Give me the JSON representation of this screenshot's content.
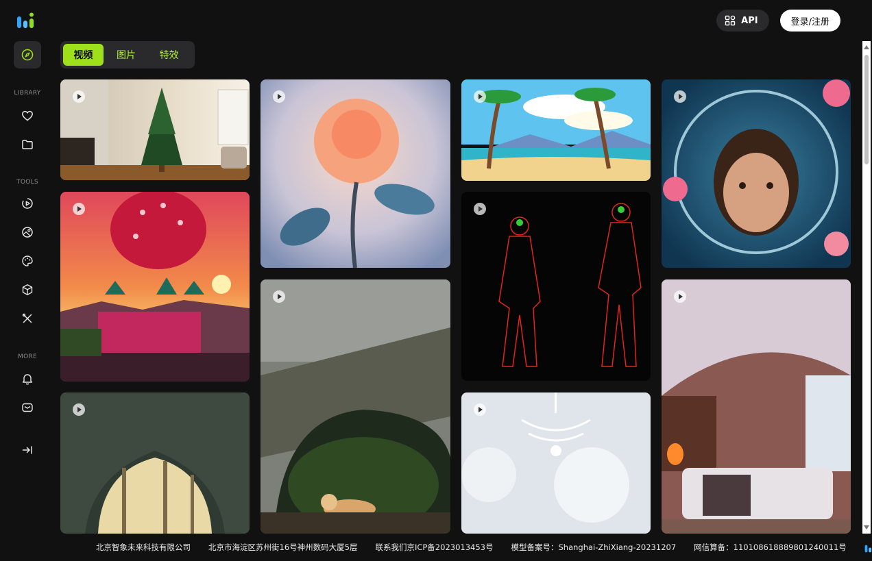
{
  "header": {
    "api_label": "API",
    "login_label": "登录/注册"
  },
  "sidebar": {
    "library_label": "LIBRARY",
    "tools_label": "TOOLS",
    "more_label": "MORE"
  },
  "tabs": [
    {
      "label": "视频",
      "active": true
    },
    {
      "label": "图片",
      "active": false
    },
    {
      "label": "特效",
      "active": false
    }
  ],
  "colors": {
    "accent": "#9ee01a",
    "background": "#111112",
    "panel": "#2a2a2c"
  },
  "icons": [
    "explore-icon",
    "heart-icon",
    "folder-icon",
    "video-tool-icon",
    "image-tool-icon",
    "palette-icon",
    "cube-icon",
    "tools-icon",
    "bell-icon",
    "mail-icon",
    "collapse-icon",
    "play-icon",
    "grid-icon"
  ],
  "footer": {
    "company": "北京智象未来科技有限公司",
    "address": "北京市海淀区苏州街16号神州数码大厦5层",
    "icp": "联系我们京ICP备2023013453号",
    "model_record": "模型备案号：Shanghai-ZhiXiang-20231207",
    "net_record": "网信算备：110108618889801240011号"
  }
}
